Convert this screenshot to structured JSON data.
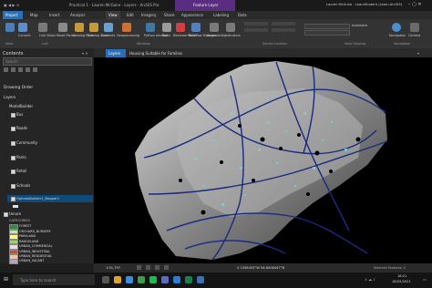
{
  "titlebar": {
    "title": "Practical 1 - Lauren McGuire - Layers - ArcGIS Pro",
    "context_tab": "Feature Layer",
    "user": "Lauren McGuire - LearnStudent (Learn.ArcGIS)"
  },
  "ribbon_tabs": [
    "Project",
    "Map",
    "Insert",
    "Analysis",
    "View",
    "Edit",
    "Imagery",
    "Share",
    "Appearance",
    "Labeling",
    "Data"
  ],
  "ribbon": {
    "buttons": [
      "Convert",
      "Link Views",
      "Reset Panes",
      "Catalog Pane",
      "Catalog View",
      "Contents",
      "Geoprocessing",
      "Python window",
      "Tasks",
      "Reviewer Rules",
      "Workflow Manager",
      "Accessibility",
      "Indicators"
    ],
    "groups": [
      "View",
      "Link",
      "Windows",
      "Device Location",
      "View Clipping",
      "Navigation"
    ],
    "right_buttons": [
      "Navigation",
      "Camera"
    ],
    "scale_label": "Automatic"
  },
  "contents": {
    "title": "Contents",
    "search_placeholder": "Search",
    "drawing_order": "Drawing Order",
    "layers_root": "Layers",
    "group": "ModelBuilder",
    "layers": [
      "Bus",
      "Roads",
      "Community",
      "Parks",
      "Retail",
      "Schools",
      "OptLessBuilder1_Mapper1"
    ],
    "tenure_layer": "tenure",
    "categories_label": "CATEGORIES",
    "legend": [
      {
        "label": "FOREST",
        "color": "#2e8b3a"
      },
      {
        "label": "ORCHARD_NURSERY",
        "color": "#c8e6a0"
      },
      {
        "label": "PARKLAND",
        "color": "#ffff80"
      },
      {
        "label": "RANGELAND",
        "color": "#a0d070"
      },
      {
        "label": "URBAN_COMMERCIAL",
        "color": "#e0e0e0"
      },
      {
        "label": "URBAN_INDUSTRIAL",
        "color": "#e84020"
      },
      {
        "label": "URBAN_RESIDENTIAL",
        "color": "#f0c8a0"
      },
      {
        "label": "URBAN_VACANT",
        "color": "#c0a0c0"
      }
    ]
  },
  "map_tabs": [
    "Layers",
    "Housing Suitable for Families"
  ],
  "statusbar": {
    "scale": "1:51,797",
    "coordinates": "2.1556453°W 56.8008447°N",
    "selected": "Selected Features: 0"
  },
  "taskbar": {
    "search_placeholder": "Type here to search",
    "time": "18:21",
    "date": "18/02/2021"
  }
}
